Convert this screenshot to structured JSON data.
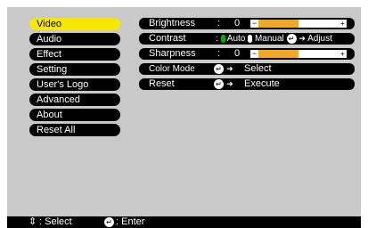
{
  "menu": [
    {
      "label": "Video",
      "selected": true
    },
    {
      "label": "Audio"
    },
    {
      "label": "Effect"
    },
    {
      "label": "Setting"
    },
    {
      "label": "User's Logo"
    },
    {
      "label": "Advanced"
    },
    {
      "label": "About"
    },
    {
      "label": "Reset All"
    }
  ],
  "settings": {
    "brightness": {
      "label": "Brightness",
      "colon": ":",
      "value": "0",
      "level": 0.5
    },
    "contrast": {
      "label": "Contrast",
      "colon": ":",
      "auto": "Auto",
      "manual": "Manual",
      "adjust": "Adjust"
    },
    "sharpness": {
      "label": "Sharpness",
      "colon": ":",
      "value": "0",
      "level": 0.5
    },
    "color_mode": {
      "label": "Color Mode",
      "action": "Select"
    },
    "reset": {
      "label": "Reset",
      "action": "Execute"
    }
  },
  "status": {
    "select": ": Select",
    "enter": ": Enter"
  },
  "colors": {
    "selected": "#f7e600",
    "slider_fill": "#f5a623",
    "auto_indicator": "#00b000",
    "panel": "#c9c9c9"
  }
}
